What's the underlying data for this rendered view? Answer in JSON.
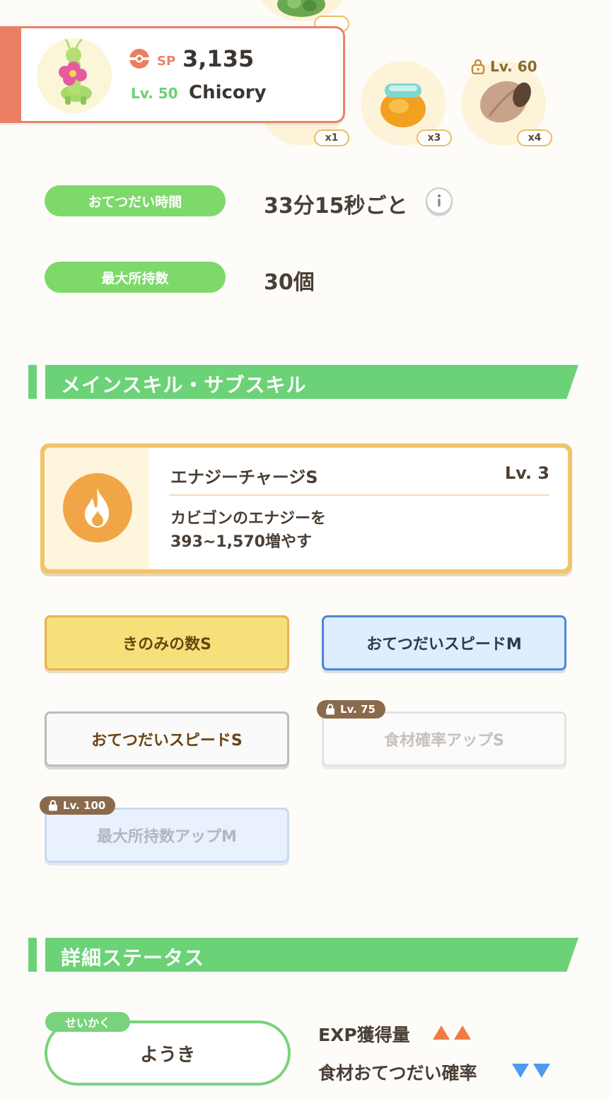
{
  "ingredients": [
    {
      "name": "ingredient-1-qty",
      "qty": "x1"
    },
    {
      "name": "ingredient-2-qty",
      "qty": "x3"
    },
    {
      "name": "ingredient-3-qty",
      "qty": "x4",
      "lock_level": "Lv. 60"
    }
  ],
  "pokemon": {
    "sp_label": "SP",
    "sp_value": "3,135",
    "level": "Lv. 50",
    "name": "Chicory"
  },
  "stats": {
    "help_time_label": "おてつだい時間",
    "help_time_value": "33分15秒ごと",
    "max_carry_label": "最大所持数",
    "max_carry_value": "30個"
  },
  "skills_section": {
    "title": "メインスキル・サブスキル"
  },
  "main_skill": {
    "name": "エナジーチャージS",
    "level": "Lv. 3",
    "description_line1": "カビゴンのエナジーを",
    "description_line2": "393~1,570増やす"
  },
  "sub_skills": [
    {
      "label": "きのみの数S"
    },
    {
      "label": "おてつだいスピードM"
    },
    {
      "label": "おてつだいスピードS"
    },
    {
      "label": "食材確率アップS",
      "lock_level": "Lv. 75"
    },
    {
      "label": "最大所持数アップM",
      "lock_level": "Lv. 100"
    }
  ],
  "details_section": {
    "title": "詳細ステータス"
  },
  "nature": {
    "tag": "せいかく",
    "value": "ようき",
    "up_label": "EXP獲得量",
    "down_label": "食材おてつだい確率"
  },
  "colors": {
    "accent_green": "#6cd277",
    "card_border": "#e8826a",
    "gold": "#f2c46a",
    "up_arrow": "#f07a44",
    "down_arrow": "#4a9bf0"
  }
}
